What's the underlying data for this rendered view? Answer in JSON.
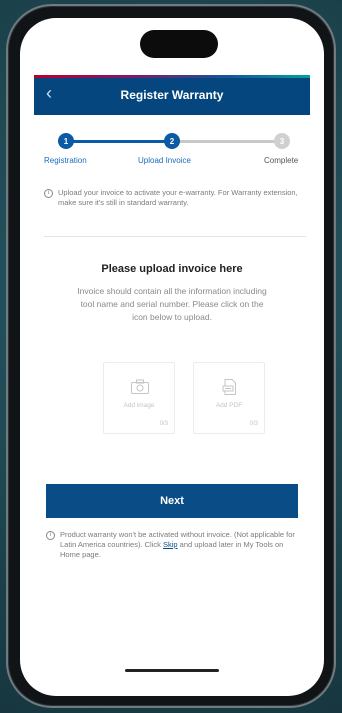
{
  "header": {
    "back_icon": "back-chevron-icon",
    "title": "Register Warranty"
  },
  "stepper": {
    "steps": [
      {
        "number": "1",
        "label": "Registration",
        "state": "done"
      },
      {
        "number": "2",
        "label": "Upload Invoice",
        "state": "current"
      },
      {
        "number": "3",
        "label": "Complete",
        "state": "pending"
      }
    ],
    "active_color": "#0a5aa6",
    "inactive_color": "#c8c8c8"
  },
  "info": {
    "icon": "info-icon",
    "text": "Upload your invoice to activate your e-warranty. For Warranty extension, make sure it's still in standard warranty."
  },
  "upload": {
    "title": "Please upload invoice here",
    "description": "Invoice should contain all the information including tool name and serial number. Please click on the icon below to upload.",
    "tiles": [
      {
        "icon": "camera-icon",
        "label": "Add image",
        "count": "0/3"
      },
      {
        "icon": "pdf-document-icon",
        "label": "Add PDF",
        "count": "0/3"
      }
    ]
  },
  "actions": {
    "next_label": "Next",
    "button_color": "#0a4d86"
  },
  "note": {
    "icon": "info-icon",
    "text_before": "Product warranty won't be activated without invoice. (Not applicable for Latin America countries). Click",
    "skip_label": "Skip",
    "text_after": "and upload later in My Tools on Home page."
  }
}
